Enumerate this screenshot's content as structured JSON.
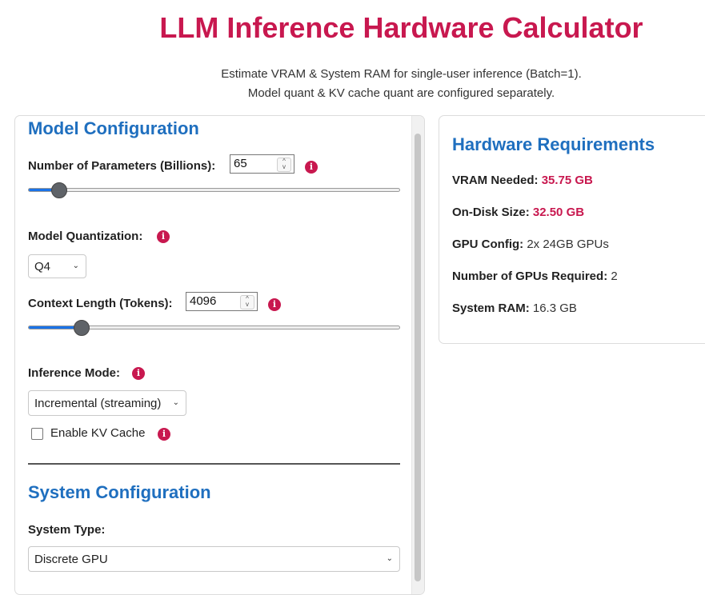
{
  "header": {
    "title": "LLM Inference Hardware Calculator",
    "subtitle_line1": "Estimate VRAM & System RAM for single-user inference (Batch=1).",
    "subtitle_line2": "Model quant & KV cache quant are configured separately."
  },
  "model_config": {
    "heading": "Model Configuration",
    "params_label": "Number of Parameters (Billions):",
    "params_value": "65",
    "params_slider_fraction": 0.08,
    "quant_label": "Model Quantization:",
    "quant_value": "Q4",
    "context_label": "Context Length (Tokens):",
    "context_value": "4096",
    "context_slider_fraction": 0.14,
    "mode_label": "Inference Mode:",
    "mode_value": "Incremental (streaming)",
    "kv_cache_label": "Enable KV Cache",
    "kv_cache_checked": false
  },
  "system_config": {
    "heading": "System Configuration",
    "type_label": "System Type:",
    "type_value": "Discrete GPU"
  },
  "requirements": {
    "heading": "Hardware Requirements",
    "vram_label": "VRAM Needed:",
    "vram_value": "35.75 GB",
    "disk_label": "On-Disk Size:",
    "disk_value": "32.50 GB",
    "gpu_config_label": "GPU Config:",
    "gpu_config_value": "2x 24GB GPUs",
    "num_gpus_label": "Number of GPUs Required:",
    "num_gpus_value": "2",
    "sys_ram_label": "System RAM:",
    "sys_ram_value": "16.3 GB"
  },
  "colors": {
    "accent": "#c8184f",
    "heading_blue": "#1f6fbf",
    "slider_fill": "#1a73e8"
  },
  "icons": {
    "info": "info-icon",
    "chevron": "chevron-down-icon"
  }
}
